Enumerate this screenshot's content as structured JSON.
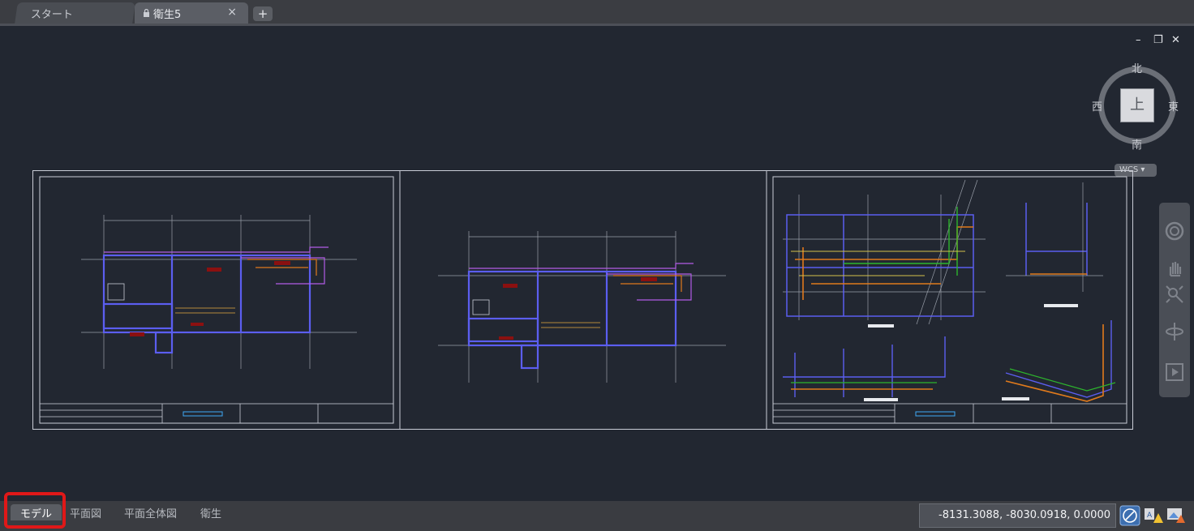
{
  "doc_tabs": {
    "start": "スタート",
    "active": "衛生5",
    "close": "×",
    "add": "+"
  },
  "viewcube": {
    "north": "北",
    "south": "南",
    "west": "西",
    "east": "東",
    "face": "上",
    "wcs": "WCS"
  },
  "window_controls": {
    "minimize": "–",
    "restore": "❐",
    "close": "✕"
  },
  "layout_tabs": [
    "モデル",
    "平面図",
    "平面全体図",
    "衛生"
  ],
  "status": {
    "coordinates": "-8131.3088, -8030.0918, 0.0000"
  },
  "colors": {
    "background": "#222731",
    "highlight": "#e01818",
    "pipe_blue": "#5b5ef0",
    "pipe_purple": "#b25be6",
    "pipe_orange": "#e07a1c",
    "pipe_green": "#2db52d"
  },
  "icons": {
    "lock": "lock-icon",
    "orbit": "orbit-icon",
    "pan": "pan-hand-icon",
    "zoom": "zoom-extents-icon",
    "steering": "steering-wheel-icon",
    "showmotion": "showmotion-icon",
    "ortho": "ortho-icon",
    "annotation": "annotation-scale-icon",
    "workspace": "workspace-icon"
  }
}
